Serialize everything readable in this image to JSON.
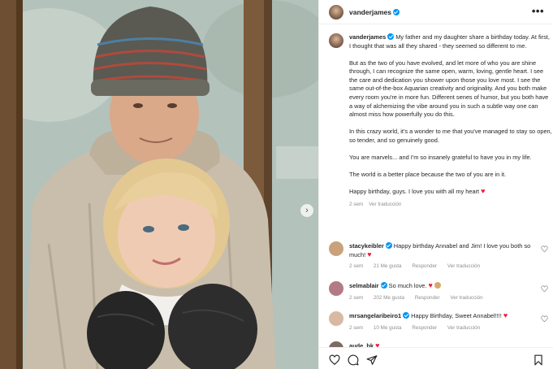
{
  "photo": {
    "alt": "",
    "next_icon": "chevron-right-icon"
  },
  "header": {
    "username": "vanderjames",
    "verified_icon": "verified-badge-icon",
    "more_icon": "more-options-icon"
  },
  "caption": {
    "username": "vanderjames",
    "paragraphs": [
      "My father and my daughter share a birthday today. At first, I thought that was all they shared - they seemed so different to me.",
      "But as the two of you have evolved, and let more of who you are shine through, I can recognize the same open, warm, loving, gentle heart. I see the care and dedication you shower upon those you love most. I see the same out-of-the-box Aquarian creativity and originality. And you both make every room you're in more fun. Different senes of humor, but you both have a way of alchemizing the vibe around you in such a subtle way one can almost miss how powerfully you do this.",
      "In this crazy world, it's a wonder to me that you've managed to stay so open, so tender, and so genuinely good.",
      "You are marvels... and I'm so insanely grateful to have you in my life.",
      "The world is a better place because the two of you are in it."
    ],
    "closing": "Happy birthday, guys. I love you with all my heart",
    "closing_emoji": "♥",
    "time": "2 sem",
    "translate": "Ver traducción"
  },
  "comments": [
    {
      "username": "stacykeibler",
      "text": "Happy birthday Annabel and Jim! I love you both so much!",
      "emoji": "♥",
      "time": "2 sem",
      "likes": "21 Me gusta",
      "reply": "Responder",
      "translate": "Ver traducción",
      "avatar_color": "#c9a27c"
    },
    {
      "username": "selmablair",
      "text": "So much love.",
      "emoji": "♥",
      "time": "2 sem",
      "likes": "202 Me gusta",
      "reply": "Responder",
      "translate": "Ver traducción",
      "avatar_color": "#b27b86"
    },
    {
      "username": "mrsangelaribeiro1",
      "text": "Happy Birthday, Sweet Annabel!!!!",
      "emoji": "♥",
      "time": "2 sem",
      "likes": "10 Me gusta",
      "reply": "Responder",
      "translate": "Ver traducción",
      "avatar_color": "#d9b9a4"
    },
    {
      "username": "aude_bk",
      "text": "",
      "emoji": "♥",
      "avatar_color": "#7d6b62"
    }
  ],
  "actions": {
    "like_icon": "heart-icon",
    "comment_icon": "comment-icon",
    "share_icon": "share-icon",
    "save_icon": "bookmark-icon"
  },
  "colors": {
    "verified": "#0095f6",
    "heart": "#ed1c3b",
    "meta_text": "#8e8e8e"
  }
}
